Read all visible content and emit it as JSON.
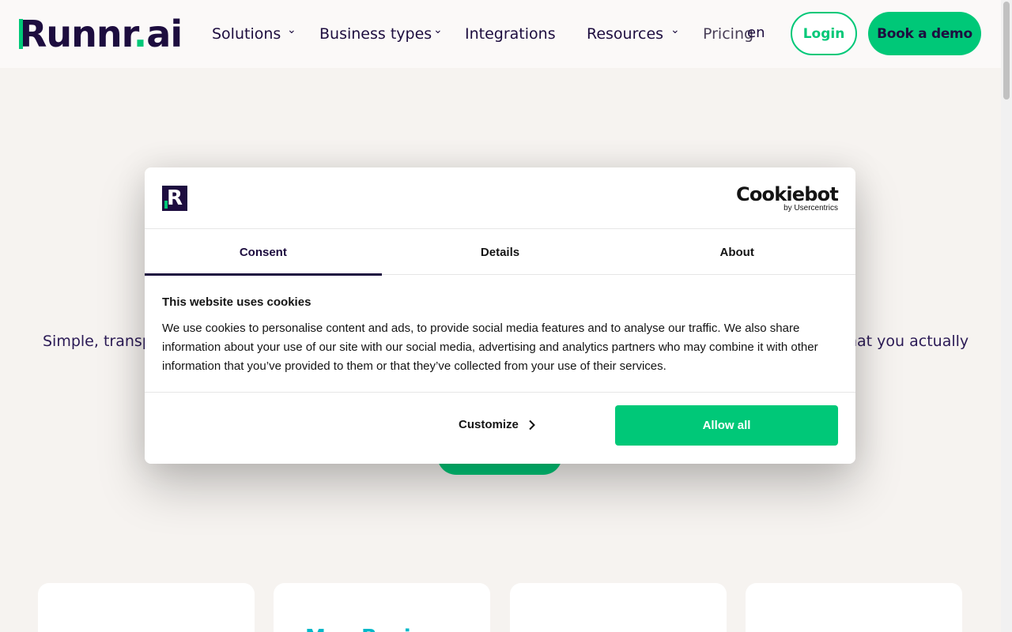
{
  "header": {
    "logo_main": "Runnr",
    "logo_dot": ".",
    "logo_suffix": "ai",
    "nav": {
      "solutions": "Solutions",
      "business_types": "Business types",
      "integrations": "Integrations",
      "resources": "Resources",
      "pricing": "Pricing"
    },
    "chevron_glyph": "⌄",
    "language": "en",
    "login_label": "Login",
    "demo_label": "Book a demo"
  },
  "page": {
    "hero_sub_left": "Simple, transpa",
    "hero_sub_right": "hat you actually",
    "card_logo_partial": "Man Busi"
  },
  "cookie_modal": {
    "brand_mark": "R",
    "provider_name": "Cookiebot",
    "provider_by": "by Usercentrics",
    "tabs": [
      {
        "label": "Consent",
        "active": true
      },
      {
        "label": "Details",
        "active": false
      },
      {
        "label": "About",
        "active": false
      }
    ],
    "title": "This website uses cookies",
    "text": "We use cookies to personalise content and ads, to provide social media features and to analyse our traffic. We also share information about your use of our site with our social media, advertising and analytics partners who may combine it with other information that you’ve provided to them or that they’ve collected from your use of their services.",
    "customize_label": "Customize",
    "allow_label": "Allow all"
  },
  "colors": {
    "brand_green": "#00c878",
    "brand_navy": "#1d0d3f",
    "page_bg": "#f6f3f0"
  }
}
